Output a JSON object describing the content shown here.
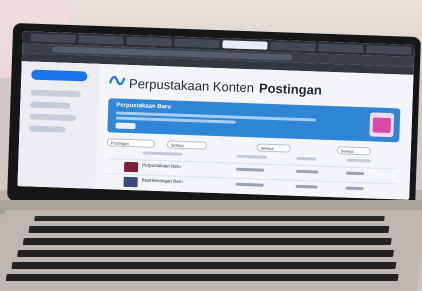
{
  "app": {
    "brand_small": "",
    "title": "Perpustakaan Konten",
    "subtitle": "Postingan"
  },
  "sidebar": {
    "new_button": "",
    "items": [
      "",
      "",
      "",
      ""
    ]
  },
  "banner": {
    "title": "Perpustakaan Baru"
  },
  "filters": {
    "chips": [
      "Postingan",
      "Semua",
      "Semua",
      "Semua"
    ]
  },
  "rows": [
    {
      "title": "Perpustakaan Baru"
    },
    {
      "title": "Buat kenangan Baru"
    }
  ],
  "colors": {
    "accent": "#2f86d6",
    "calendar": "#d94aa7"
  }
}
